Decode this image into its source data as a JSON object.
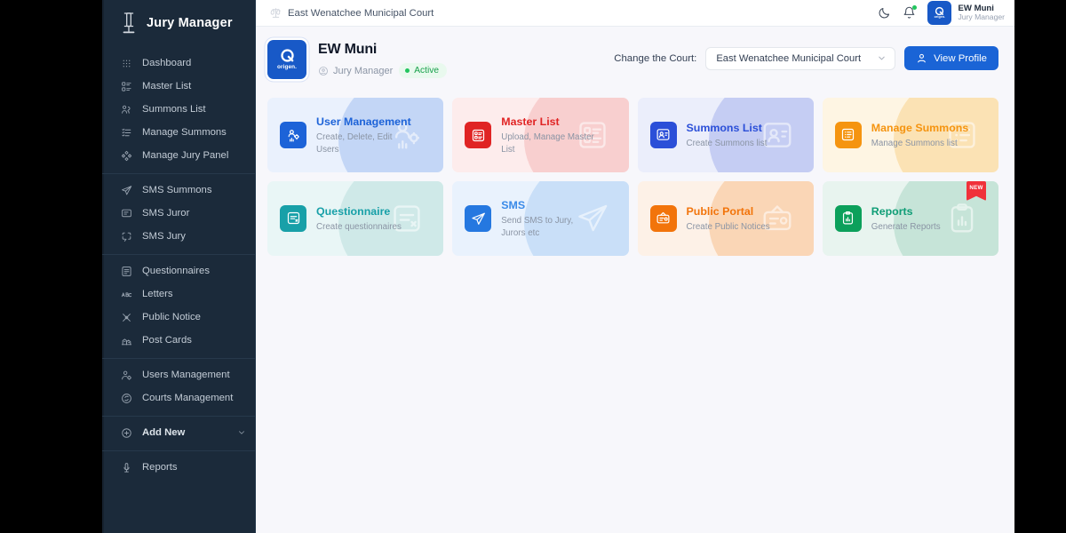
{
  "brand": {
    "title": "Jury Manager",
    "logo_icon": "gavel-icon"
  },
  "sidebar": {
    "groups": [
      {
        "items": [
          {
            "label": "Dashboard",
            "icon": "grid-dots-icon"
          },
          {
            "label": "Master List",
            "icon": "list-blocks-icon"
          },
          {
            "label": "Summons List",
            "icon": "users-group-icon"
          },
          {
            "label": "Manage Summons",
            "icon": "list-checks-icon"
          },
          {
            "label": "Manage Jury Panel",
            "icon": "diamonds-icon"
          }
        ]
      },
      {
        "items": [
          {
            "label": "SMS Summons",
            "icon": "paper-plane-icon"
          },
          {
            "label": "SMS Juror",
            "icon": "message-square-icon"
          },
          {
            "label": "SMS Jury",
            "icon": "message-dashed-icon"
          }
        ]
      },
      {
        "items": [
          {
            "label": "Questionnaires",
            "icon": "form-icon"
          },
          {
            "label": "Letters",
            "icon": "letters-abc-icon"
          },
          {
            "label": "Public Notice",
            "icon": "megaphone-icon"
          },
          {
            "label": "Post Cards",
            "icon": "postcard-icon"
          }
        ]
      },
      {
        "items": [
          {
            "label": "Users Management",
            "icon": "user-cog-icon"
          },
          {
            "label": "Courts Management",
            "icon": "scales-circle-icon"
          }
        ]
      },
      {
        "items": [
          {
            "label": "Add New",
            "icon": "plus-circle-icon",
            "bold": true,
            "chevron": "chevron-down-icon"
          }
        ]
      },
      {
        "items": [
          {
            "label": "Reports",
            "icon": "report-icon"
          }
        ]
      }
    ]
  },
  "topbar": {
    "breadcrumb": "East Wenatchee Municipal Court",
    "breadcrumb_icon": "scales-icon",
    "theme_toggle_icon": "moon-icon",
    "notifications_icon": "bell-icon",
    "avatar": {
      "logo_wordmark": "origen.",
      "name": "EW Muni",
      "role": "Jury Manager"
    }
  },
  "profile": {
    "logo_wordmark": "origen.",
    "org_name": "EW Muni",
    "role": "Jury Manager",
    "role_icon": "badge-icon",
    "status": "Active",
    "change_court_label": "Change the Court:",
    "selected_court": "East Wenatchee Municipal Court",
    "view_profile_label": "View Profile",
    "view_profile_icon": "user-icon"
  },
  "colors": {
    "accent_blue": "#1a64d6",
    "sidebar_bg": "#1b2a3a",
    "page_bg": "#f7f7fb",
    "active_green": "#22c55e",
    "new_badge_red": "#f0313a"
  },
  "cards": [
    {
      "title": "User Management",
      "desc": "Create, Delete, Edit Users",
      "icon": "users-settings-icon",
      "icon_bg": "#1d63d8",
      "title_color": "#1d63d8",
      "bg": "#eaf1fd",
      "blob": "#c3d6f6",
      "ghost": "users-settings-icon",
      "badge": null
    },
    {
      "title": "Master List",
      "desc": "Upload, Manage Master List",
      "icon": "master-list-icon",
      "icon_bg": "#e02424",
      "title_color": "#e02424",
      "bg": "#fdecec",
      "blob": "#f8cfcf",
      "ghost": "master-list-icon",
      "badge": null
    },
    {
      "title": "Summons List",
      "desc": "Create Summons list",
      "icon": "summons-users-icon",
      "icon_bg": "#2b4fd8",
      "title_color": "#2b4fd8",
      "bg": "#ebeefb",
      "blob": "#c5cdf3",
      "ghost": "summons-users-icon",
      "badge": null
    },
    {
      "title": "Manage Summons",
      "desc": "Manage Summons list",
      "icon": "manage-list-icon",
      "icon_bg": "#f59410",
      "title_color": "#f59410",
      "bg": "#fef5e3",
      "blob": "#fbe2b4",
      "ghost": "manage-list-icon",
      "badge": null
    },
    {
      "title": "Questionnaire",
      "desc": "Create questionnaires",
      "icon": "questionnaire-icon",
      "icon_bg": "#18a0a8",
      "title_color": "#18a0a8",
      "bg": "#e9f6f6",
      "blob": "#cfe9e8",
      "ghost": "questionnaire-icon",
      "badge": null
    },
    {
      "title": "SMS",
      "desc": "Send SMS to Jury, Jurors etc",
      "icon": "paper-plane-icon",
      "icon_bg": "#2578e0",
      "title_color": "#3a8ae8",
      "bg": "#e9f2fd",
      "blob": "#c9dff8",
      "ghost": "paper-plane-icon",
      "badge": null
    },
    {
      "title": "Public Portal",
      "desc": "Create Public Notices",
      "icon": "public-portal-icon",
      "icon_bg": "#f2740b",
      "title_color": "#f2740b",
      "bg": "#fdf1e7",
      "blob": "#fad6b6",
      "ghost": "public-portal-icon",
      "badge": null
    },
    {
      "title": "Reports",
      "desc": "Generate Reports",
      "icon": "report-clipboard-icon",
      "icon_bg": "#0ca05b",
      "title_color": "#0f9d76",
      "bg": "#e8f4ef",
      "blob": "#c6e4d8",
      "ghost": "report-clipboard-icon",
      "badge": "NEW"
    }
  ]
}
